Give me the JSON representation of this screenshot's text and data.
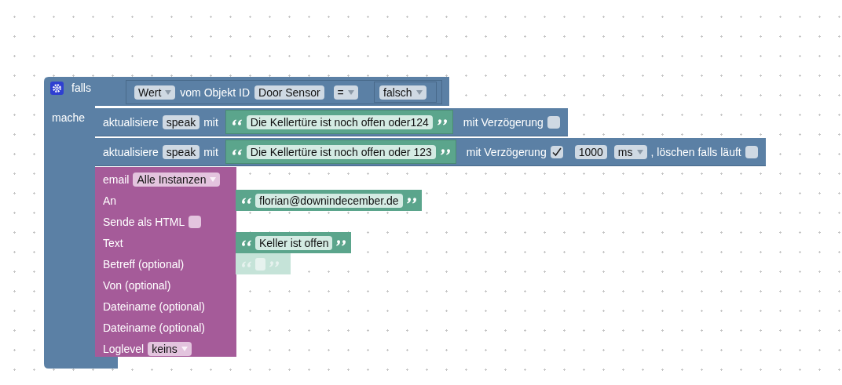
{
  "if_block": {
    "label": "falls",
    "do_label": "mache",
    "condition": {
      "property": "Wert",
      "text": "vom Objekt ID",
      "object_id": "Door Sensor",
      "operator": "=",
      "value": "falsch"
    }
  },
  "statements": [
    {
      "label": "aktualisiere",
      "state": "speak",
      "with_label": "mit",
      "string": "Die Kellertüre ist noch offen oder124",
      "delay_label": "mit Verzögerung",
      "delay_checked": false
    },
    {
      "label": "aktualisiere",
      "state": "speak",
      "with_label": "mit",
      "string": "Die Kellertüre ist noch offen oder 123",
      "delay_label": "mit Verzögerung",
      "delay_checked": true,
      "delay": "1000",
      "unit": "ms",
      "clear_label": ", löschen falls läuft",
      "clear_checked": false
    }
  ],
  "email": {
    "rows": [
      {
        "label": "email",
        "kind": "dropdown",
        "value": "Alle Instanzen"
      },
      {
        "label": "An",
        "kind": "string_input",
        "string": "florian@downindecember.de"
      },
      {
        "label": "Sende als HTML",
        "kind": "checkbox",
        "checked": false
      },
      {
        "label": "Text",
        "kind": "string_input",
        "string": "Keller ist offen"
      },
      {
        "label": "Betreff (optional)",
        "kind": "shadow_input"
      },
      {
        "label": "Von (optional)",
        "kind": "input"
      },
      {
        "label": "Dateiname (optional)",
        "kind": "input"
      },
      {
        "label": "Dateiname (optional)",
        "kind": "input"
      },
      {
        "label": "Loglevel",
        "kind": "dropdown",
        "value": "keins"
      }
    ]
  }
}
